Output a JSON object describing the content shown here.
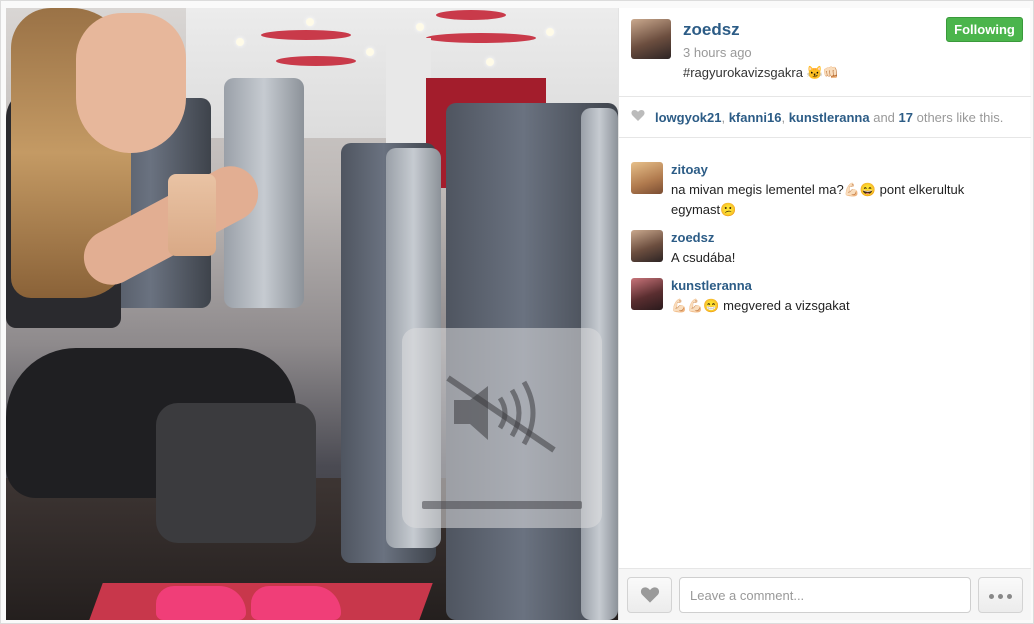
{
  "post": {
    "owner": "zoedsz",
    "time": "3 hours ago",
    "caption": "#ragyurokavizsgakra 😼👊🏻",
    "follow_label": "Following"
  },
  "likes": {
    "user1": "lowgyok21",
    "sep1": ", ",
    "user2": "kfanni16",
    "sep2": ", ",
    "user3": "kunstleranna",
    "and": " and ",
    "count": "17",
    "suffix": " others like this."
  },
  "comments": [
    {
      "user": "zitoay",
      "text": "na mivan megis lementel ma?💪🏻😄 pont elkerultuk egymast😕"
    },
    {
      "user": "zoedsz",
      "text": "A csudába!"
    },
    {
      "user": "kunstleranna",
      "text": "💪🏻💪🏻😁 megvered a vizsgakat"
    }
  ],
  "footer": {
    "comment_placeholder": "Leave a comment..."
  },
  "icons": {
    "mute": "speaker-muted-icon",
    "heart": "heart-icon",
    "more": "more-dots-icon"
  },
  "colors": {
    "username": "#2c5c86",
    "follow_button": "#4bb54c",
    "muted_text": "#999999"
  }
}
